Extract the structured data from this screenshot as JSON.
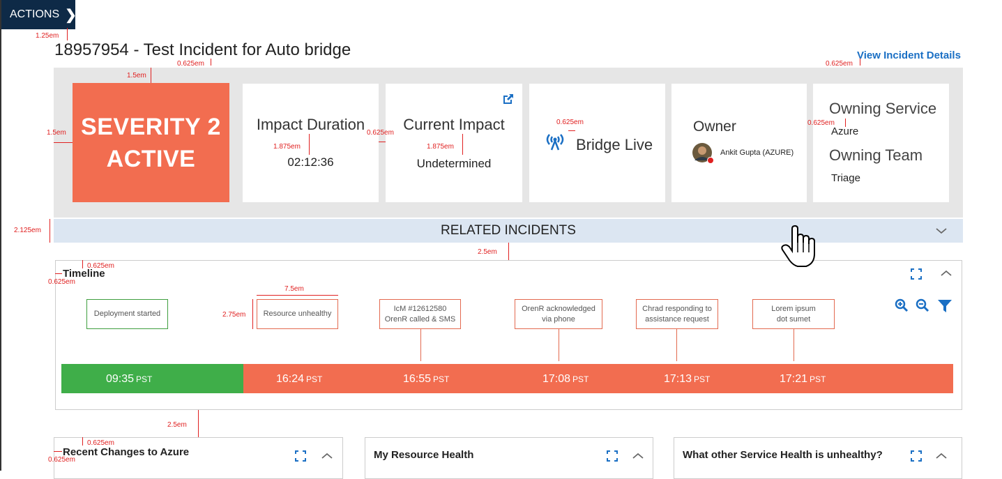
{
  "actions": {
    "label": "ACTIONS"
  },
  "incident": {
    "title": "18957954 - Test Incident for Auto bridge"
  },
  "view_details": "View Incident Details",
  "severity": {
    "line1": "SEVERITY 2",
    "line2": "ACTIVE",
    "color": "#f26d50"
  },
  "cards": {
    "impact_duration": {
      "title": "Impact Duration",
      "value": "02:12:36"
    },
    "current_impact": {
      "title": "Current Impact",
      "value": "Undetermined"
    },
    "bridge": {
      "label": "Bridge Live"
    },
    "owner": {
      "title": "Owner",
      "name": "Ankit Gupta (AZURE)"
    },
    "owning_service": {
      "title": "Owning Service",
      "value": "Azure"
    },
    "owning_team": {
      "title": "Owning Team",
      "value": "Triage"
    }
  },
  "related": {
    "label": "RELATED INCIDENTS"
  },
  "timeline": {
    "title": "Timeline",
    "events": [
      {
        "label": "Deployment started"
      },
      {
        "label": "Resource unhealthy"
      },
      {
        "line1": "IcM #12612580",
        "line2": "OrenR called & SMS"
      },
      {
        "line1": "OrenR acknowledged",
        "line2": "via phone"
      },
      {
        "line1": "Chrad responding to",
        "line2": "assistance request"
      },
      {
        "line1": "Lorem ipsum",
        "line2": "dot sumet"
      }
    ],
    "times": [
      {
        "time": "09:35",
        "tz": "PST"
      },
      {
        "time": "16:24",
        "tz": "PST"
      },
      {
        "time": "16:55",
        "tz": "PST"
      },
      {
        "time": "17:08",
        "tz": "PST"
      },
      {
        "time": "17:13",
        "tz": "PST"
      },
      {
        "time": "17:21",
        "tz": "PST"
      }
    ],
    "colors": {
      "healthy": "#3fae49",
      "unhealthy": "#f26d50"
    }
  },
  "panels": {
    "recent_changes": "Recent Changes to Azure",
    "resource_health": "My Resource Health",
    "service_health": "What other Service Health is unhealthy?"
  },
  "annotations": {
    "a1": "1.25em",
    "a2": "0.625em",
    "a3": "1.5em",
    "a4": "1.5em",
    "a5": "1.875em",
    "a6": "0.625em",
    "a7": "1.875em",
    "a8": "0.625em",
    "a9": "0.625em",
    "a10": "0.625em",
    "a11": "2.125em",
    "a12": "2.5em",
    "a13": "0.625em",
    "a14": "0.625em",
    "a15": "7.5em",
    "a16": "2.75em",
    "a17": "2.5em",
    "a18": "0.625em",
    "a19": "0.625em"
  }
}
